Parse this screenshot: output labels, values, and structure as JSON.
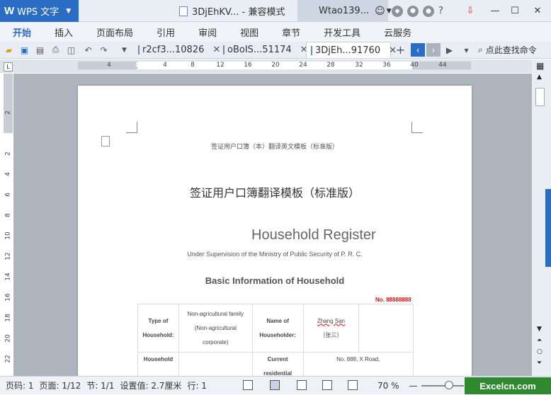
{
  "app": {
    "name": "WPS 文字"
  },
  "title_tab": {
    "label": "3DjEhKV... - 兼容模式"
  },
  "user": {
    "name": "Wtao139..."
  },
  "menu": {
    "items": [
      "开始",
      "插入",
      "页面布局",
      "引用",
      "审阅",
      "视图",
      "章节",
      "开发工具",
      "云服务"
    ]
  },
  "file_tabs": [
    {
      "label": "r2cf3...10826"
    },
    {
      "label": "oBoIS...51174"
    },
    {
      "label": "3DjEh...91760"
    }
  ],
  "search": {
    "label": "点此查找命令"
  },
  "ruler": {
    "h_ticks": [
      "4",
      "2",
      "4",
      "8",
      "12",
      "16",
      "20",
      "24",
      "28",
      "32",
      "36",
      "40",
      "44"
    ],
    "v_ticks": [
      "2",
      "2",
      "4",
      "6",
      "8",
      "10",
      "12",
      "14",
      "16",
      "18",
      "20",
      "22"
    ]
  },
  "document": {
    "header_text": "签证用户口簿（本）翻译英文模板（标准版）",
    "zh_title": "签证用户口簿翻译模板（标准版）",
    "en_title": "Household Register",
    "en_subtitle": "Under Supervision of the Ministry of Public Security of P. R. C.",
    "section_title": "Basic Information of Household",
    "doc_no": "No. 88888888",
    "table": {
      "type_label_1": "Type of",
      "type_label_2": "Household:",
      "type_value_1": "Non-agricultural family",
      "type_value_2": "(Non-agricultural",
      "type_value_3": "corporate)",
      "holder_label_1": "Name of",
      "holder_label_2": "Householder:",
      "holder_value_1": "Zhang San",
      "holder_value_2": "（张三）",
      "household_label": "Household",
      "current_label_1": "Current",
      "current_label_2": "residential",
      "address_value": "No. 888, X Road,"
    }
  },
  "status": {
    "page_no": "页码: 1",
    "pages": "页面: 1/12",
    "section": "节: 1/1",
    "setting": "设置值: 2.7厘米",
    "line": "行: 1",
    "zoom": "70 %"
  },
  "watermark": {
    "text": "Excelcn.com"
  }
}
